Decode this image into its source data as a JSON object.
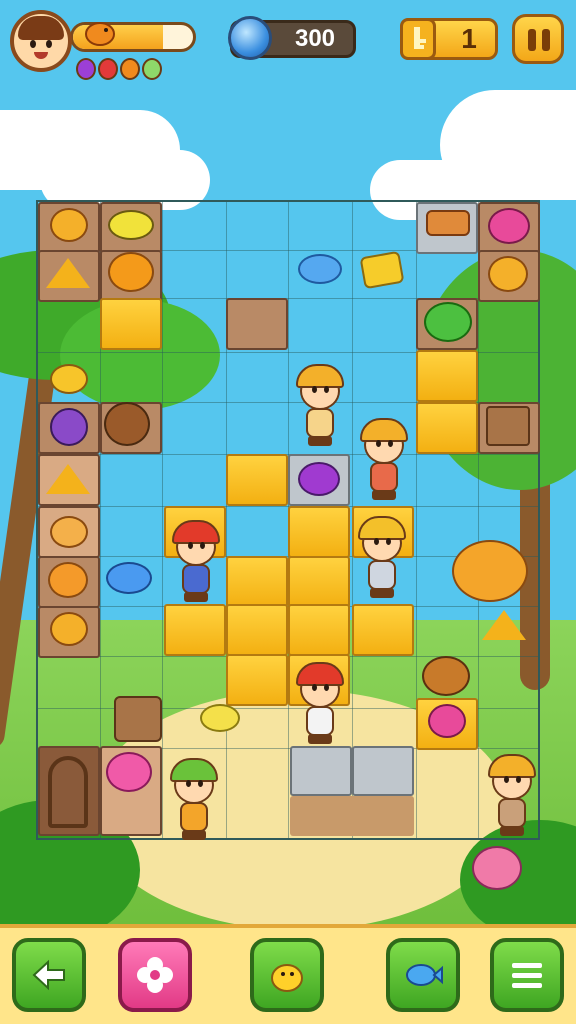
{
  "hud": {
    "gems": "300",
    "keys": "1",
    "xp_progress_fraction": 0.75,
    "orb_colors": [
      "#9c3fd6",
      "#e23a3a",
      "#f08a1e",
      "#8ed86a"
    ]
  },
  "icons": {
    "avatar": "player-avatar-icon",
    "gem": "blue-gem-icon",
    "key": "key-icon",
    "pause": "pause-icon",
    "back": "back-arrow-icon",
    "flower": "flower-icon",
    "chick": "chick-icon",
    "fish": "fish-icon",
    "menu": "menu-icon"
  },
  "colors": {
    "sky": "#55c6ee",
    "accent_yellow": "#f3b012",
    "accent_green": "#3fa622",
    "accent_pink": "#e23a86"
  }
}
